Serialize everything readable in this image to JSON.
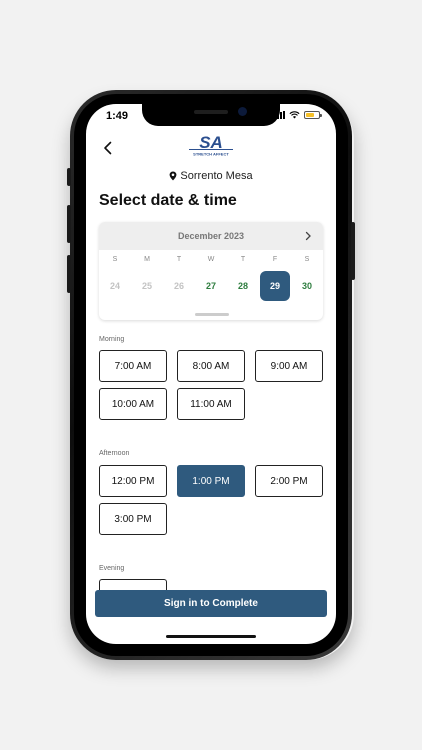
{
  "status_bar": {
    "time": "1:49"
  },
  "header": {
    "logo_text": "SA",
    "logo_subtext": "STRETCH AFFECT",
    "location": "Sorrento Mesa"
  },
  "page": {
    "title": "Select date & time"
  },
  "calendar": {
    "month": "December 2023",
    "weekdays": [
      "S",
      "M",
      "T",
      "W",
      "T",
      "F",
      "S"
    ],
    "days": [
      {
        "label": "24",
        "state": "disabled"
      },
      {
        "label": "25",
        "state": "disabled"
      },
      {
        "label": "26",
        "state": "disabled"
      },
      {
        "label": "27",
        "state": "available"
      },
      {
        "label": "28",
        "state": "available"
      },
      {
        "label": "29",
        "state": "selected"
      },
      {
        "label": "30",
        "state": "available"
      }
    ]
  },
  "sections": {
    "morning": {
      "label": "Morning",
      "slots": [
        "7:00 AM",
        "8:00 AM",
        "9:00 AM",
        "10:00 AM",
        "11:00 AM"
      ]
    },
    "afternoon": {
      "label": "Afternoon",
      "slots": [
        "12:00 PM",
        "1:00 PM",
        "2:00 PM",
        "3:00 PM"
      ],
      "selected": "1:00 PM"
    },
    "evening": {
      "label": "Evening"
    }
  },
  "cta": {
    "label": "Sign in to Complete"
  },
  "colors": {
    "primary": "#2f5a7e",
    "available": "#2e7d3f",
    "disabled": "#c3c3c3",
    "battery": "#f6c028"
  }
}
